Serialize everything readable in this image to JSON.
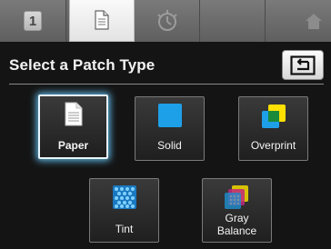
{
  "tabs": [
    {
      "id": "job",
      "label": "1",
      "icon": "number-1-icon",
      "active": false
    },
    {
      "id": "patch",
      "label": "",
      "icon": "document-icon",
      "active": true
    },
    {
      "id": "measure",
      "label": "",
      "icon": "timer-icon",
      "active": false
    },
    {
      "id": "blank",
      "label": "",
      "icon": "",
      "active": false
    },
    {
      "id": "home",
      "label": "",
      "icon": "home-icon",
      "active": false
    }
  ],
  "header": {
    "title": "Select a Patch Type",
    "back_icon": "back-arrow-icon"
  },
  "patch_types": [
    {
      "id": "paper",
      "label": "Paper",
      "icon": "paper-icon",
      "selected": true
    },
    {
      "id": "solid",
      "label": "Solid",
      "icon": "solid-square-icon",
      "selected": false
    },
    {
      "id": "overprint",
      "label": "Overprint",
      "icon": "overprint-icon",
      "selected": false
    },
    {
      "id": "tint",
      "label": "Tint",
      "icon": "tint-dots-icon",
      "selected": false
    },
    {
      "id": "gray-balance",
      "label": "Gray\nBalance",
      "label_line1": "Gray",
      "label_line2": "Balance",
      "icon": "gray-balance-icon",
      "selected": false
    }
  ],
  "colors": {
    "cyan": "#1ea0e8",
    "yellow": "#ffe000",
    "green": "#1a8a3a",
    "selection_glow": "#5fb8e6"
  }
}
